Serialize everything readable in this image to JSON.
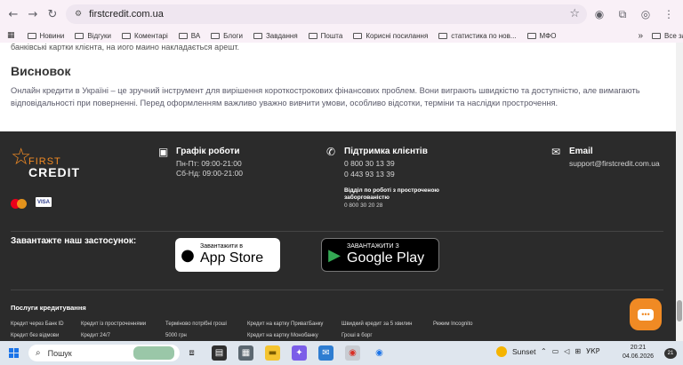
{
  "browser": {
    "url": "firstcredit.com.ua",
    "bookmarks": [
      "Новини",
      "Відгуки",
      "Коментарі",
      "ВА",
      "Блоги",
      "Завдання",
      "Пошта",
      "Корисні посилання",
      "статистика по нов...",
      "МФО"
    ],
    "all_bookmarks_label": "Все закладки",
    "more_label": "»"
  },
  "content": {
    "cut_text": "банківські картки клієнта, на иого маино накладається арешт.",
    "section_title": "Висновок",
    "paragraph": "Онлайн кредити в Україні – це зручний інструмент для вирішення короткострокових фінансових проблем. Вони виграють швидкістю та доступністю, але вимагають відповідальності при поверненні. Перед оформленням важливо уважно вивчити умови, особливо відсотки, терміни та наслідки прострочення."
  },
  "footer": {
    "logo_first": "FIRST",
    "logo_credit": "CREDIT",
    "visa": "VISA",
    "schedule": {
      "title": "Графік роботи",
      "line1": "Пн-Пт: 09:00-21:00",
      "line2": "Сб-Нд: 09:00-21:00"
    },
    "support": {
      "title": "Підтримка клієнтів",
      "phone1": "0 800 30 13 39",
      "phone2": "0 443 93 13 39",
      "overdue_title": "Відділ по роботі з простроченою заборгованістю",
      "overdue_phone": "0 800 30 20 28"
    },
    "email": {
      "title": "Email",
      "value": "support@firstcredit.com.ua"
    },
    "app_title": "Завантажте наш застосунок:",
    "appstore": {
      "small": "Завантажити в",
      "big": "App Store"
    },
    "googleplay": {
      "small": "ЗАВАНТАЖИТИ З",
      "big": "Google Play"
    },
    "services_title": "Послуги кредитування",
    "services": [
      "Кредит через Банк ID",
      "Кредит із простроченнями",
      "Терміново потрібні гроші",
      "Кредит на картку ПриватБанку",
      "Швидкий кредит за 5 хвилин",
      "Режим Incognito",
      "Кредит без відмови",
      "Кредит 24/7",
      "5000 грн",
      "Кредит на картку Монобанку",
      "Гроші в борг"
    ]
  },
  "taskbar": {
    "search_label": "Пошук",
    "weather_label": "Sunset",
    "lang": "УКР",
    "time": "20:21",
    "date": "04.06.2026",
    "notif_count": "21"
  },
  "colors": {
    "accent": "#f08a24",
    "footer_bg": "#2b2b2b"
  }
}
